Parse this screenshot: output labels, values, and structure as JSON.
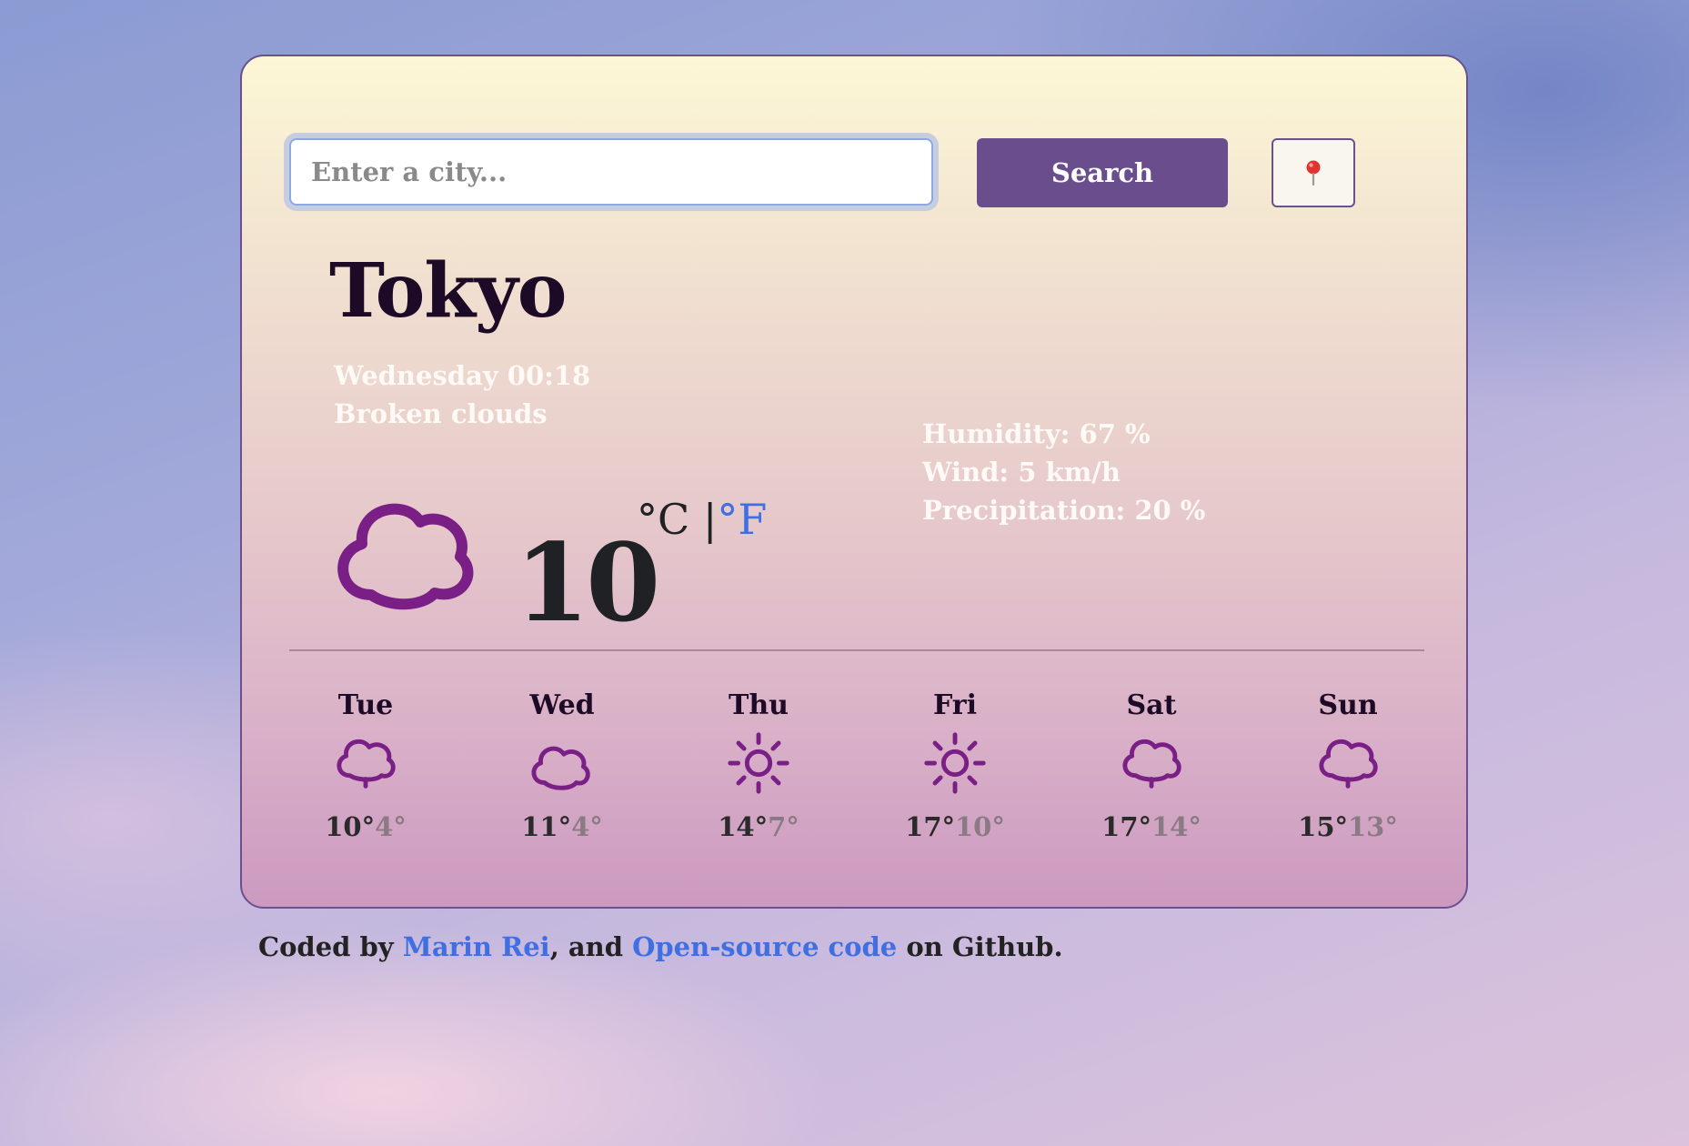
{
  "search": {
    "placeholder": "Enter a city...",
    "value": "",
    "button_label": "Search"
  },
  "location_button": {
    "icon": "pin-icon"
  },
  "current": {
    "city": "Tokyo",
    "datetime": "Wednesday 00:18",
    "description": "Broken clouds",
    "temperature": "10",
    "unit_celsius": "°C",
    "unit_separator": "|",
    "unit_fahrenheit": "°F",
    "icon": "cloud-icon",
    "details": {
      "humidity": "Humidity: 67 %",
      "wind": "Wind: 5 km/h",
      "precipitation": "Precipitation: 20 %"
    }
  },
  "forecast": [
    {
      "day": "Tue",
      "icon": "rain-cloud-icon",
      "max": "10°",
      "min": "4°"
    },
    {
      "day": "Wed",
      "icon": "cloud-icon",
      "max": "11°",
      "min": "4°"
    },
    {
      "day": "Thu",
      "icon": "sun-icon",
      "max": "14°",
      "min": "7°"
    },
    {
      "day": "Fri",
      "icon": "sun-icon",
      "max": "17°",
      "min": "10°"
    },
    {
      "day": "Sat",
      "icon": "rain-cloud-icon",
      "max": "17°",
      "min": "14°"
    },
    {
      "day": "Sun",
      "icon": "rain-cloud-icon",
      "max": "15°",
      "min": "13°"
    }
  ],
  "footer": {
    "prefix": "Coded by ",
    "author_link": "Marin Rei",
    "middle": ", and ",
    "source_link": "Open-source code",
    "suffix": " on Github."
  },
  "colors": {
    "accent": "#6a4d8c",
    "icon": "#7a1f86",
    "link": "#3f6fe3",
    "title": "#1d0a26"
  }
}
